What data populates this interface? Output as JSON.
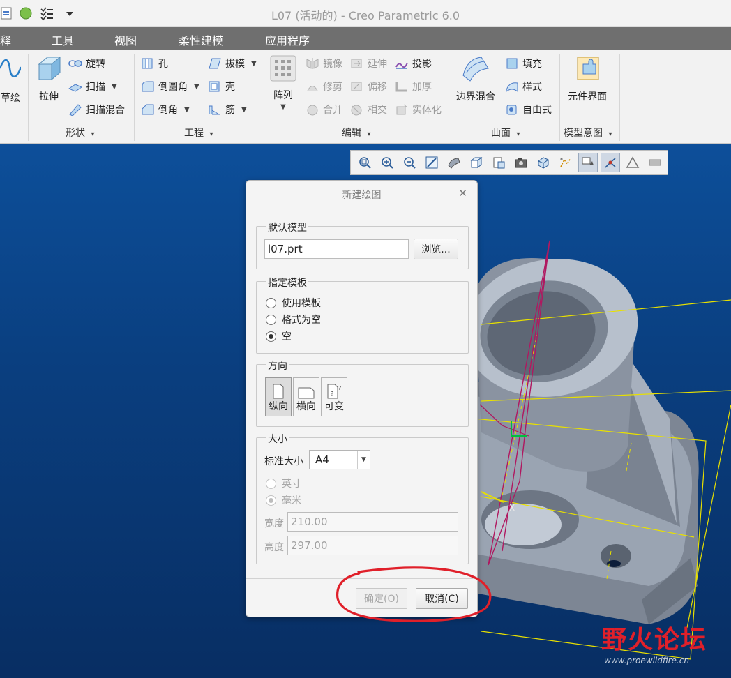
{
  "window": {
    "title": "L07 (活动的) - Creo Parametric 6.0"
  },
  "menu": [
    "释",
    "工具",
    "视图",
    "柔性建模",
    "应用程序"
  ],
  "ribbon": {
    "sketch": "草绘",
    "shape": {
      "extrude": "拉伸",
      "revolve": "旋转",
      "sweep": "扫描",
      "swept_blend": "扫描混合",
      "group": "形状"
    },
    "engineering": {
      "hole": "孔",
      "round": "倒圆角",
      "chamfer": "倒角",
      "draft": "拔模",
      "shell": "壳",
      "rib": "筋",
      "group": "工程"
    },
    "editing": {
      "pattern": "阵列",
      "mirror": "镜像",
      "trim": "修剪",
      "merge": "合并",
      "extend": "延伸",
      "offset": "偏移",
      "intersect": "相交",
      "project": "投影",
      "thicken": "加厚",
      "solidify": "实体化",
      "group": "编辑"
    },
    "surfaces": {
      "boundary_blend": "边界混合",
      "fill": "填充",
      "style": "样式",
      "freestyle": "自由式",
      "group": "曲面"
    },
    "model_intent": {
      "component_interface": "元件界面",
      "group": "模型意图"
    }
  },
  "dialog": {
    "title": "新建绘图",
    "default_model": {
      "legend": "默认模型",
      "value": "l07.prt",
      "browse": "浏览..."
    },
    "template": {
      "legend": "指定模板",
      "options": [
        "使用模板",
        "格式为空",
        "空"
      ],
      "selected": "空"
    },
    "orientation": {
      "legend": "方向",
      "options": [
        "纵向",
        "横向",
        "可变"
      ],
      "selected": "纵向"
    },
    "size": {
      "legend": "大小",
      "std_label": "标准大小",
      "std_value": "A4",
      "units": [
        "英寸",
        "毫米"
      ],
      "selected_unit": "毫米",
      "width_label": "宽度",
      "width_value": "210.00",
      "height_label": "高度",
      "height_value": "297.00"
    },
    "ok": "确定(O)",
    "cancel": "取消(C)"
  },
  "watermark": {
    "text": "野火论坛",
    "url": "www.proewildfire.cn"
  },
  "colors": {
    "accent_red": "#e0202a",
    "viewport": "#0a3f80",
    "menubar": "#6f6f6f"
  }
}
